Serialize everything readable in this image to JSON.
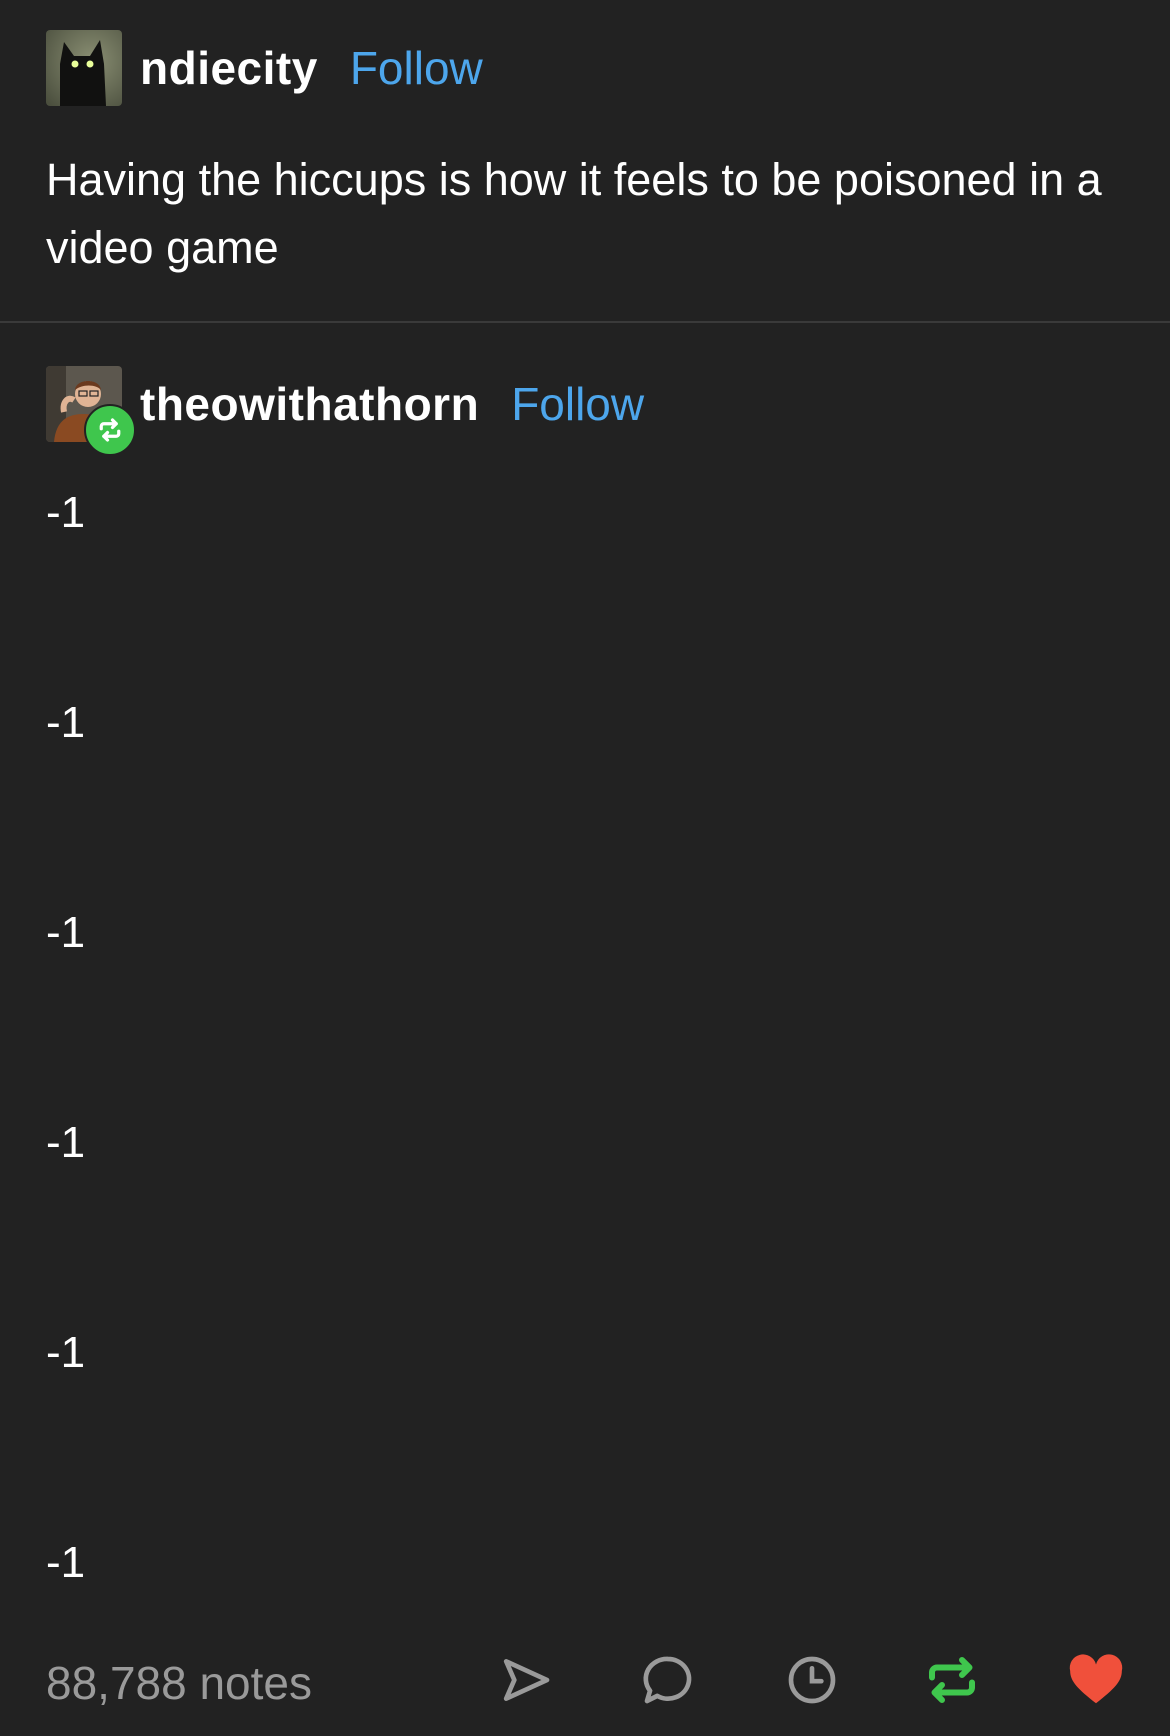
{
  "posts": [
    {
      "username": "ndiecity",
      "follow_label": "Follow",
      "text": "Having the hiccups is how it feels to be poisoned in a video game"
    },
    {
      "username": "theowithathorn",
      "follow_label": "Follow",
      "lines": [
        "-1",
        "-1",
        "-1",
        "-1",
        "-1",
        "-1"
      ]
    }
  ],
  "footer": {
    "notes": "88,788 notes",
    "actions": [
      "share-icon",
      "reply-icon",
      "schedule-icon",
      "reblog-icon",
      "like-icon"
    ],
    "colors": {
      "reblog": "#3fc64d",
      "like": "#f0503b",
      "muted": "#9a9a9a",
      "link": "#4da6ec"
    }
  }
}
